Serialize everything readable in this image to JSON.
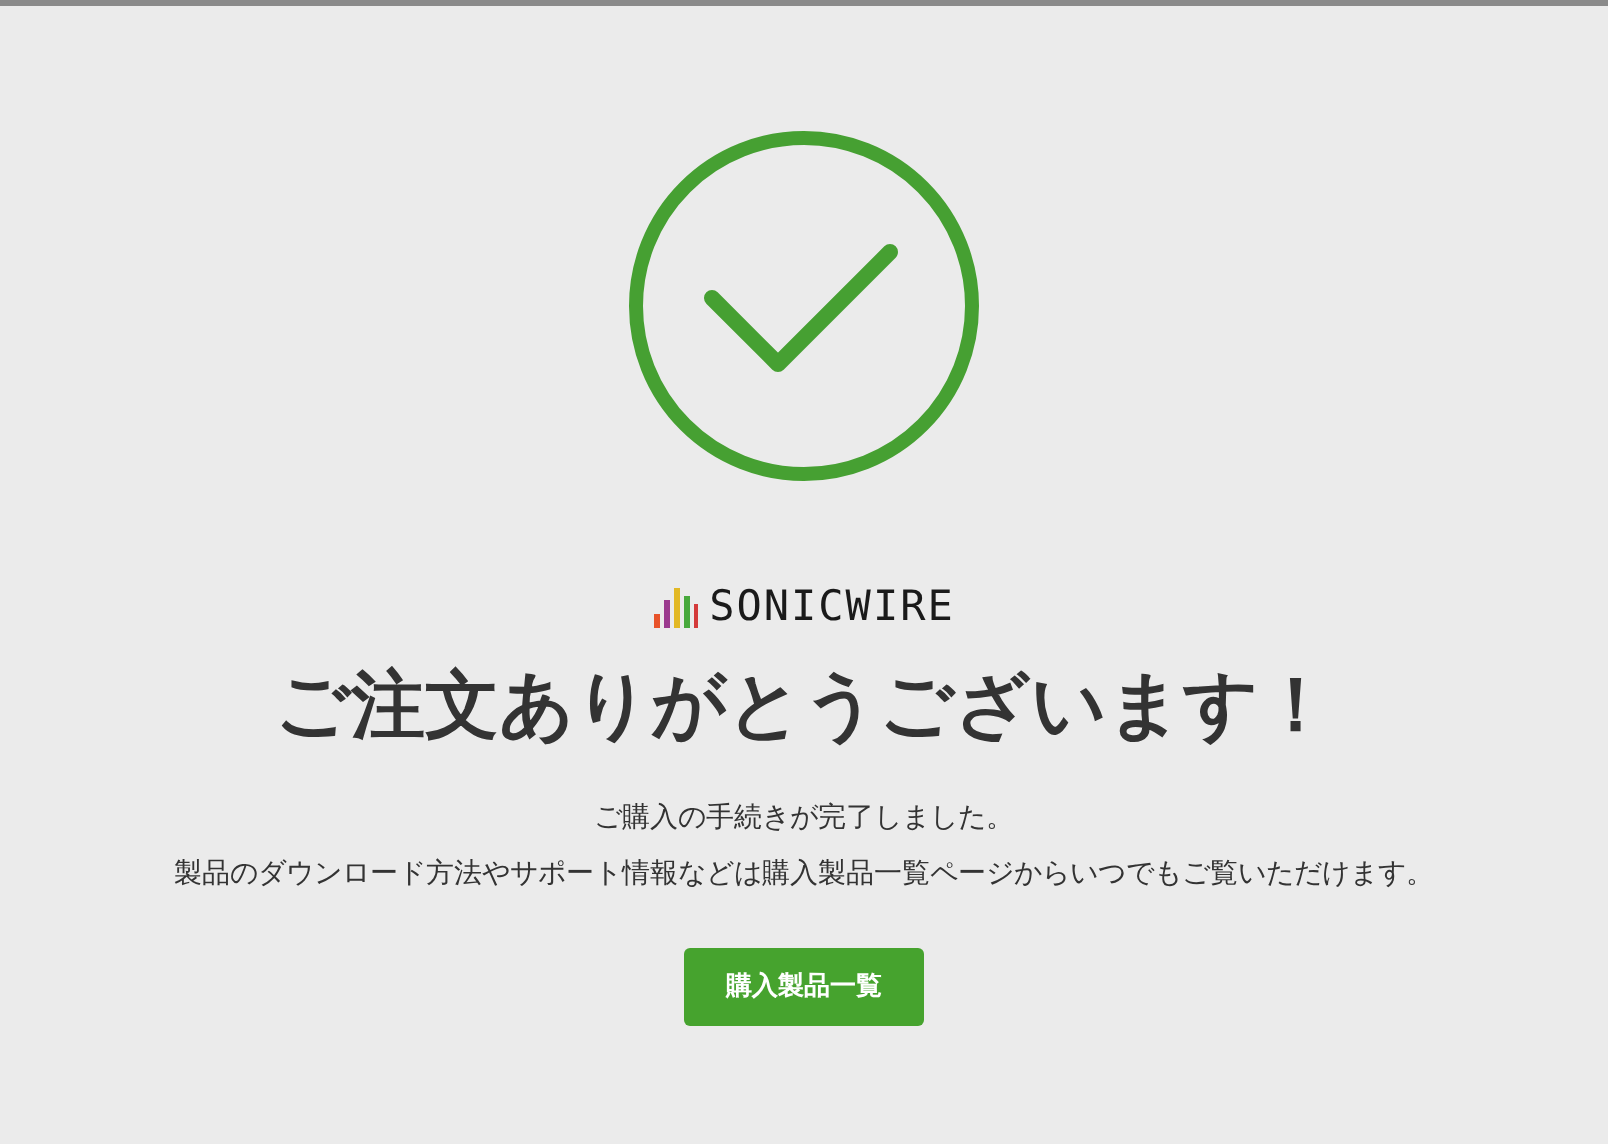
{
  "logo": {
    "text": "SONICWIRE"
  },
  "heading": "ご注文ありがとうございます！",
  "messages": [
    "ご購入の手続きが完了しました。",
    "製品のダウンロード方法やサポート情報などは購入製品一覧ページからいつでもご覧いただけます。"
  ],
  "button": {
    "label": "購入製品一覧"
  }
}
